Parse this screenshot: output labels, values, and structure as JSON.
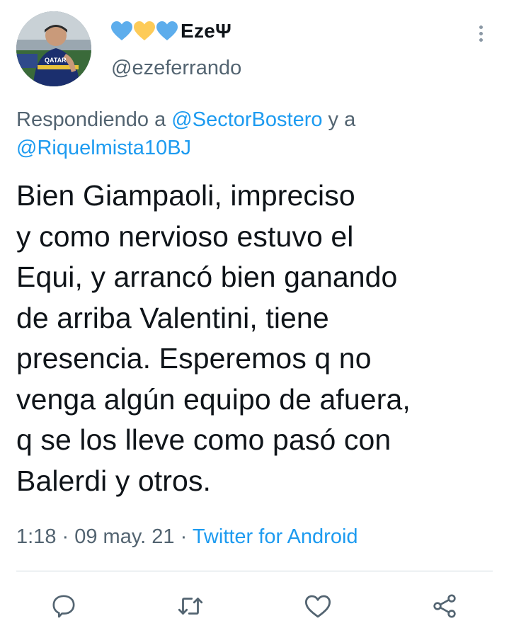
{
  "user": {
    "display_name": "EzeΨ",
    "handle": "@ezeferrando",
    "hearts": [
      "blue-heart",
      "yellow-heart",
      "blue-heart"
    ],
    "avatar_jersey_text": "QATAR"
  },
  "reply": {
    "prefix": "Respondiendo a ",
    "mention_1": "@SectorBostero",
    "joiner": " y a",
    "mention_2": "@Riquelmista10BJ"
  },
  "tweet": {
    "text": "Bien Giampaoli, impreciso\ny como nervioso estuvo el\nEqui, y arrancó bien ganando\nde arriba Valentini, tiene\npresencia. Esperemos q no\nvenga algún equipo de afuera,\nq se los lleve como pasó con\nBalerdi y otros."
  },
  "meta": {
    "time": "1:18",
    "separator": " · ",
    "date": "09 may. 21",
    "source": "Twitter for Android"
  },
  "actions": [
    "reply-icon",
    "retweet-icon",
    "like-icon",
    "share-icon"
  ],
  "colors": {
    "link": "#1d9bf0",
    "secondary_text": "#536471",
    "primary_text": "#0f1419",
    "heart_blue": "#5dadec",
    "heart_yellow": "#fdcb58"
  }
}
